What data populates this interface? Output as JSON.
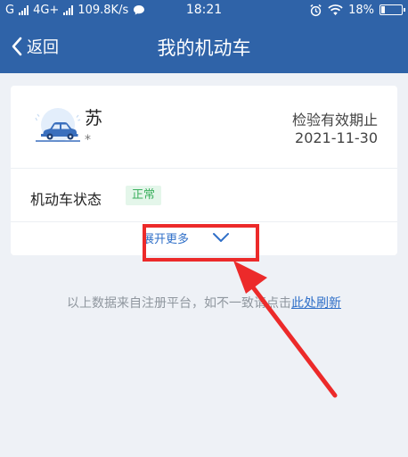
{
  "status_bar": {
    "carrier_g": "G",
    "network": "4G+",
    "speed": "109.8K/s",
    "time": "18:21",
    "battery": "18%",
    "battery_level": 0.18
  },
  "header": {
    "back_label": "返回",
    "title": "我的机动车"
  },
  "vehicle": {
    "plate": "苏",
    "plate_sub": "*",
    "inspection_label": "检验有效期止",
    "inspection_date": "2021-11-30",
    "status_label": "机动车状态",
    "status_value": "正常",
    "expand_label": "展开更多"
  },
  "note": {
    "text": "以上数据来自注册平台，如不一致请点击",
    "link": "此处刷新"
  },
  "colors": {
    "header_bg": "#2f63a8",
    "link": "#2f6fc8",
    "badge_green": "#3cb05f",
    "annotation_red": "#ec2a2a"
  }
}
